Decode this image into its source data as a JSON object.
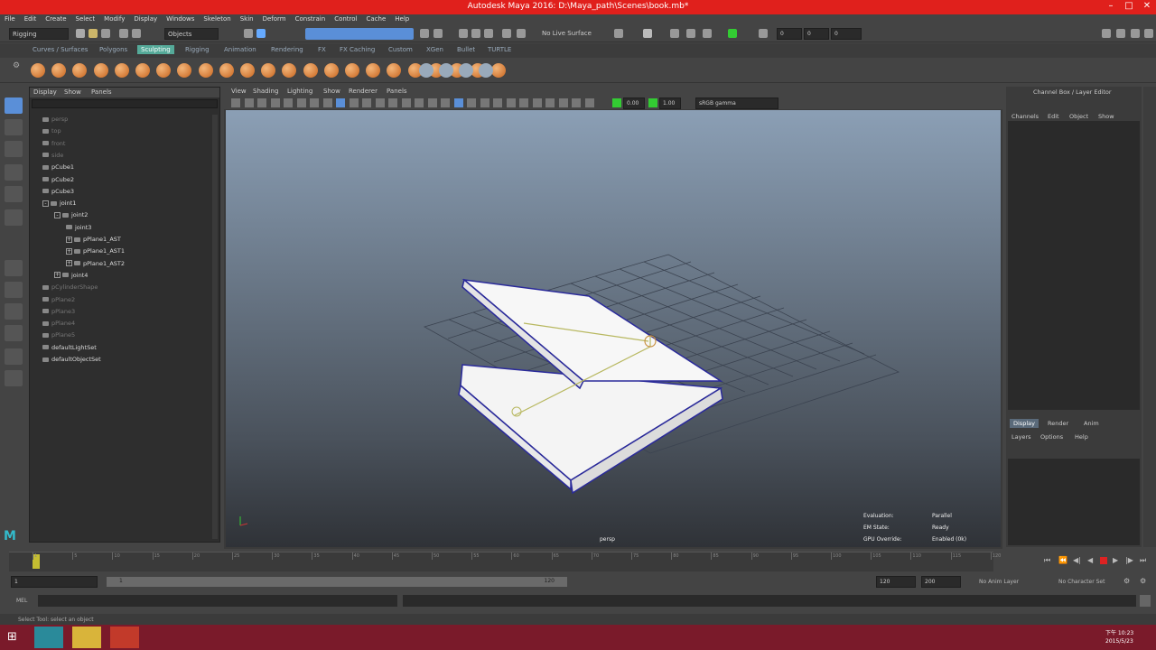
{
  "window": {
    "title": "Autodesk Maya 2016: D:\\Maya_path\\Scenes\\book.mb*"
  },
  "menubar": [
    "File",
    "Edit",
    "Create",
    "Select",
    "Modify",
    "Display",
    "Windows",
    "Skeleton",
    "Skin",
    "Deform",
    "Constrain",
    "Control",
    "Cache",
    "Help"
  ],
  "statusline": {
    "mode": "Rigging",
    "select_mode": "Objects",
    "live_surface": "No Live Surface",
    "xyz": [
      "0",
      "0",
      "0"
    ]
  },
  "shelf_tabs": [
    "Curves / Surfaces",
    "Polygons",
    "Sculpting",
    "Rigging",
    "Animation",
    "Rendering",
    "FX",
    "FX Caching",
    "Custom",
    "XGen",
    "Bullet",
    "TURTLE"
  ],
  "shelf_active": "Sculpting",
  "outliner": {
    "menu": [
      "Display",
      "Show",
      "Panels"
    ],
    "items": [
      {
        "label": "persp",
        "indent": 0,
        "dim": true
      },
      {
        "label": "top",
        "indent": 0,
        "dim": true
      },
      {
        "label": "front",
        "indent": 0,
        "dim": true
      },
      {
        "label": "side",
        "indent": 0,
        "dim": true
      },
      {
        "label": "pCube1",
        "indent": 0,
        "dim": false
      },
      {
        "label": "pCube2",
        "indent": 0,
        "dim": false
      },
      {
        "label": "pCube3",
        "indent": 0,
        "dim": false
      },
      {
        "label": "joint1",
        "indent": 0,
        "dim": false,
        "exp": "-"
      },
      {
        "label": "joint2",
        "indent": 1,
        "dim": false,
        "exp": "-"
      },
      {
        "label": "joint3",
        "indent": 2,
        "dim": false
      },
      {
        "label": "pPlane1_AST",
        "indent": 2,
        "dim": false,
        "exp": "+"
      },
      {
        "label": "pPlane1_AST1",
        "indent": 2,
        "dim": false,
        "exp": "+"
      },
      {
        "label": "pPlane1_AST2",
        "indent": 2,
        "dim": false,
        "exp": "+"
      },
      {
        "label": "joint4",
        "indent": 1,
        "dim": false,
        "exp": "+"
      },
      {
        "label": "pCylinderShape",
        "indent": 0,
        "dim": true
      },
      {
        "label": "pPlane2",
        "indent": 0,
        "dim": true
      },
      {
        "label": "pPlane3",
        "indent": 0,
        "dim": true
      },
      {
        "label": "pPlane4",
        "indent": 0,
        "dim": true
      },
      {
        "label": "pPlane5",
        "indent": 0,
        "dim": true
      },
      {
        "label": "defaultLightSet",
        "indent": 0,
        "dim": false
      },
      {
        "label": "defaultObjectSet",
        "indent": 0,
        "dim": false
      }
    ]
  },
  "viewport": {
    "menu": [
      "View",
      "Shading",
      "Lighting",
      "Show",
      "Renderer",
      "Panels"
    ],
    "exposure": "0.00",
    "gamma": "1.00",
    "colorspace": "sRGB gamma",
    "camera": "persp",
    "hud": [
      {
        "k": "Evaluation:",
        "v": "Parallel"
      },
      {
        "k": "EM State:",
        "v": "Ready"
      },
      {
        "k": "GPU Override:",
        "v": "Enabled (0k)"
      }
    ]
  },
  "channelbox": {
    "title": "Channel Box / Layer Editor",
    "menu": [
      "Channels",
      "Edit",
      "Object",
      "Show"
    ],
    "layer_tabs": [
      "Display",
      "Render",
      "Anim"
    ],
    "layer_menu": [
      "Layers",
      "Options",
      "Help"
    ]
  },
  "timeslider": {
    "ticks": [
      "1",
      "5",
      "10",
      "15",
      "20",
      "25",
      "30",
      "35",
      "40",
      "45",
      "50",
      "55",
      "60",
      "65",
      "70",
      "75",
      "80",
      "85",
      "90",
      "95",
      "100",
      "105",
      "110",
      "115",
      "120"
    ]
  },
  "range": {
    "start": "1",
    "inner_start": "1",
    "inner_end": "120",
    "end": "120",
    "max": "200",
    "anim_layer": "No Anim Layer",
    "char_set": "No Character Set"
  },
  "cmdline": {
    "label": "MEL"
  },
  "helpline": "Select Tool: select an object",
  "taskbar": {
    "time": "下午 10:23",
    "date": "2015/5/23"
  }
}
